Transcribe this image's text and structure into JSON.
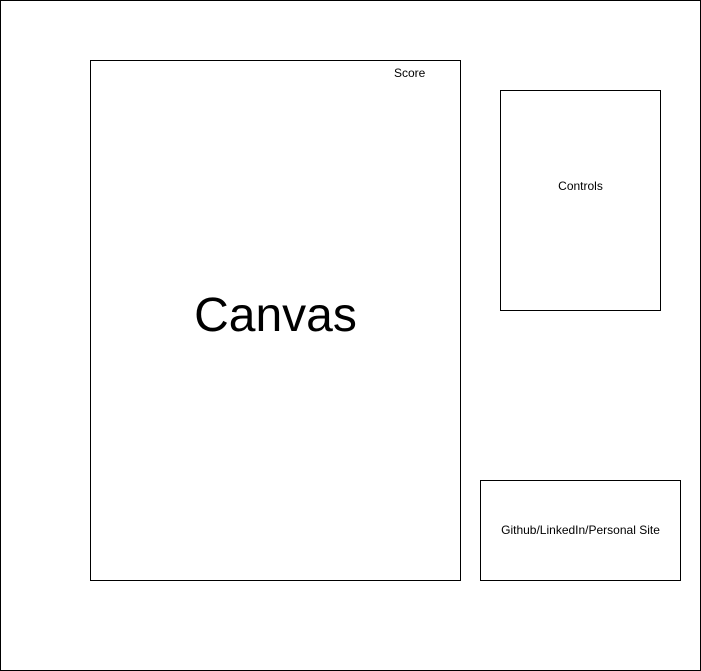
{
  "canvas": {
    "label": "Canvas",
    "score_label": "Score"
  },
  "controls": {
    "label": "Controls"
  },
  "links": {
    "label": "Github/LinkedIn/Personal Site"
  }
}
